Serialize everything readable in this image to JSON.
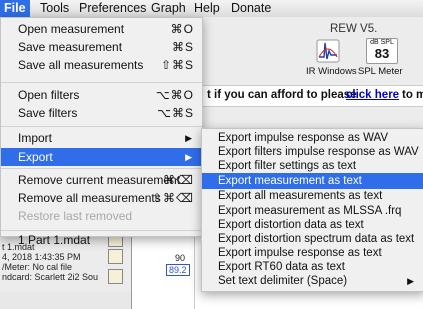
{
  "menubar": {
    "items": [
      "File",
      "Tools",
      "Preferences",
      "Graph",
      "Help",
      "Donate"
    ]
  },
  "window": {
    "title": "REW V5.",
    "toolbar": {
      "ir_windows_label": "IR Windows",
      "spl_meter_label": "SPL Meter",
      "spl_unit": "dB SPL",
      "spl_value": "83"
    },
    "banner": {
      "text": "t if you can afford to please",
      "link": "click here",
      "tail": "to m"
    },
    "info_lines": [
      "t 1.mdat",
      "4, 2018 1:43:35 PM",
      "/Meter: No cal file",
      "ndcard: Scarlett 2i2 Sou"
    ],
    "graph": {
      "ticks": [
        "95",
        "90"
      ],
      "boxed_value": "89.2"
    }
  },
  "file_menu": {
    "items": [
      {
        "label": "Open measurement",
        "shortcut": "⌘O"
      },
      {
        "label": "Save measurement",
        "shortcut": "⌘S"
      },
      {
        "label": "Save all measurements",
        "shortcut": "⇧⌘S"
      },
      {
        "label": "Open filters",
        "shortcut": "⌥⌘O"
      },
      {
        "label": "Save filters",
        "shortcut": "⌥⌘S"
      },
      {
        "label": "Import",
        "shortcut": "▶"
      },
      {
        "label": "Export",
        "shortcut": "▶"
      },
      {
        "label": "Remove current measurement",
        "shortcut": "⌘⌫"
      },
      {
        "label": "Remove all measurements",
        "shortcut": "⇧⌘⌫"
      },
      {
        "label": "Restore last removed",
        "shortcut": ""
      },
      {
        "label": "1 Part 1.mdat",
        "shortcut": ""
      }
    ]
  },
  "export_menu": {
    "items": [
      "Export impulse response as WAV",
      "Export filters impulse response as WAV",
      "Export filter settings as text",
      "Export measurement as text",
      "Export all measurements as text",
      "Export measurement as MLSSA .frq",
      "Export distortion data as text",
      "Export distortion spectrum data as text",
      "Export impulse response as text",
      "Export RT60 data as text",
      "Set text delimiter (Space)"
    ],
    "submenu_arrow": "▶"
  },
  "colors": {
    "highlight": "#2f6ee8",
    "link": "#0000cc"
  }
}
